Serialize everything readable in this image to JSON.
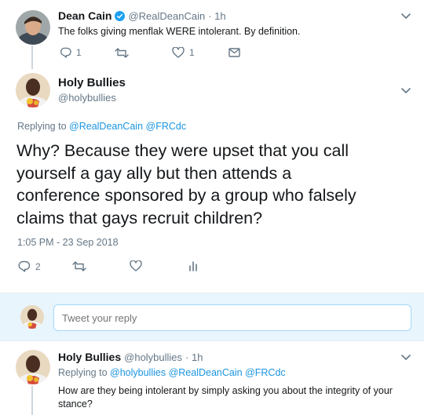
{
  "tweet1": {
    "name": "Dean Cain",
    "handle": "@RealDeanCain",
    "time": "· 1h",
    "text": "The folks giving menflak WERE intolerant.  By definition.",
    "reply_count": "1",
    "like_count": "1",
    "verified": true
  },
  "main_tweet": {
    "name": "Holy Bullies",
    "handle": "@holybullies",
    "replying_to_label": "Replying to",
    "replying_to": [
      "@RealDeanCain",
      "@FRCdc"
    ],
    "text": "Why? Because they were upset that you call yourself a gay ally but then attends a conference sponsored by a group who falsely claims that gays recruit children?",
    "text_lines": [
      "Why? Because they were upset that you call",
      "yourself a gay ally but then attends a",
      "conference sponsored by a group who falsely",
      "claims that gays recruit children?"
    ],
    "timestamp": "1:05 PM - 23 Sep 2018",
    "reply_count": "2"
  },
  "reply_box": {
    "placeholder": "Tweet your reply"
  },
  "tweet3": {
    "name": "Holy Bullies",
    "handle": "@holybullies",
    "time": "· 1h",
    "replying_to_label": "Replying to",
    "replying_to": [
      "@holybullies",
      "@RealDeanCain",
      "@FRCdc"
    ],
    "text_lines": [
      "How are they being intolerant by simply asking you about the integrity of your",
      "stance?"
    ]
  },
  "icons": {
    "reply": "reply-icon",
    "retweet": "retweet-icon",
    "like": "heart-icon",
    "dm": "envelope-icon",
    "analytics": "analytics-icon",
    "verified": "verified-badge-icon",
    "caret": "chevron-down-icon"
  },
  "colors": {
    "link": "#1b95e0",
    "muted": "#657786",
    "text": "#14171a",
    "divider": "#e6ecf0",
    "thread": "#ccd6dd"
  }
}
